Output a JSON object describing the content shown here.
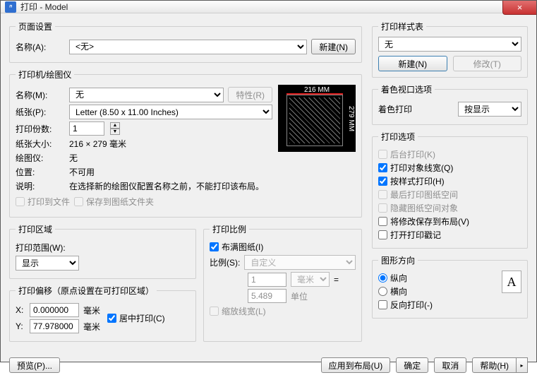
{
  "window": {
    "title": "打印 - Model",
    "close": "×"
  },
  "page_setup": {
    "legend": "页面设置",
    "name_label": "名称(A):",
    "name_value": "<无>",
    "new_button": "新建(N)"
  },
  "printer": {
    "legend": "打印机/绘图仪",
    "name_label": "名称(M):",
    "name_value": "无",
    "properties_button": "特性(R)",
    "paper_label": "纸张(P):",
    "paper_value": "Letter (8.50 x 11.00 Inches)",
    "copies_label": "打印份数:",
    "copies_value": "1",
    "size_label": "纸张大小:",
    "size_value": "216 × 279  毫米",
    "plotter_label": "绘图仪:",
    "plotter_value": "无",
    "location_label": "位置:",
    "location_value": "不可用",
    "desc_label": "说明:",
    "desc_value": "在选择新的绘图仪配置名称之前，不能打印该布局。",
    "print_to_file": "打印到文件",
    "save_to_sheet": "保存到图纸文件夹",
    "preview": {
      "width": "216 MM",
      "height": "279 MM"
    }
  },
  "area": {
    "legend": "打印区域",
    "range_label": "打印范围(W):",
    "range_value": "显示"
  },
  "offset": {
    "legend": "打印偏移（原点设置在可打印区域）",
    "x_label": "X:",
    "x_value": "0.000000",
    "x_unit": "毫米",
    "y_label": "Y:",
    "y_value": "77.978000",
    "y_unit": "毫米",
    "center": "居中打印(C)"
  },
  "scale": {
    "legend": "打印比例",
    "fit": "布满图纸(I)",
    "ratio_label": "比例(S):",
    "ratio_value": "自定义",
    "num_value": "1",
    "num_unit": "毫米",
    "equals": "=",
    "den_value": "5.489",
    "den_unit": "单位",
    "scale_lw": "缩放线宽(L)"
  },
  "style": {
    "legend": "打印样式表",
    "value": "无",
    "new": "新建(N)",
    "modify": "修改(T)"
  },
  "viewport": {
    "legend": "着色视口选项",
    "shadeplot_label": "着色打印",
    "shadeplot_value": "按显示"
  },
  "options": {
    "legend": "打印选项",
    "background": "后台打印(K)",
    "lineweights": "打印对象线宽(Q)",
    "styles": "按样式打印(H)",
    "paperspace_last": "最后打印图纸空间",
    "hide_paperspace": "隐藏图纸空间对象",
    "save_changes": "将修改保存到布局(V)",
    "stamp": "打开打印戳记"
  },
  "orientation": {
    "legend": "图形方向",
    "portrait": "纵向",
    "landscape": "横向",
    "upside": "反向打印(-)",
    "icon": "A"
  },
  "footer": {
    "preview": "预览(P)...",
    "apply": "应用到布局(U)",
    "ok": "确定",
    "cancel": "取消",
    "help": "帮助(H)",
    "expand": "▸"
  }
}
